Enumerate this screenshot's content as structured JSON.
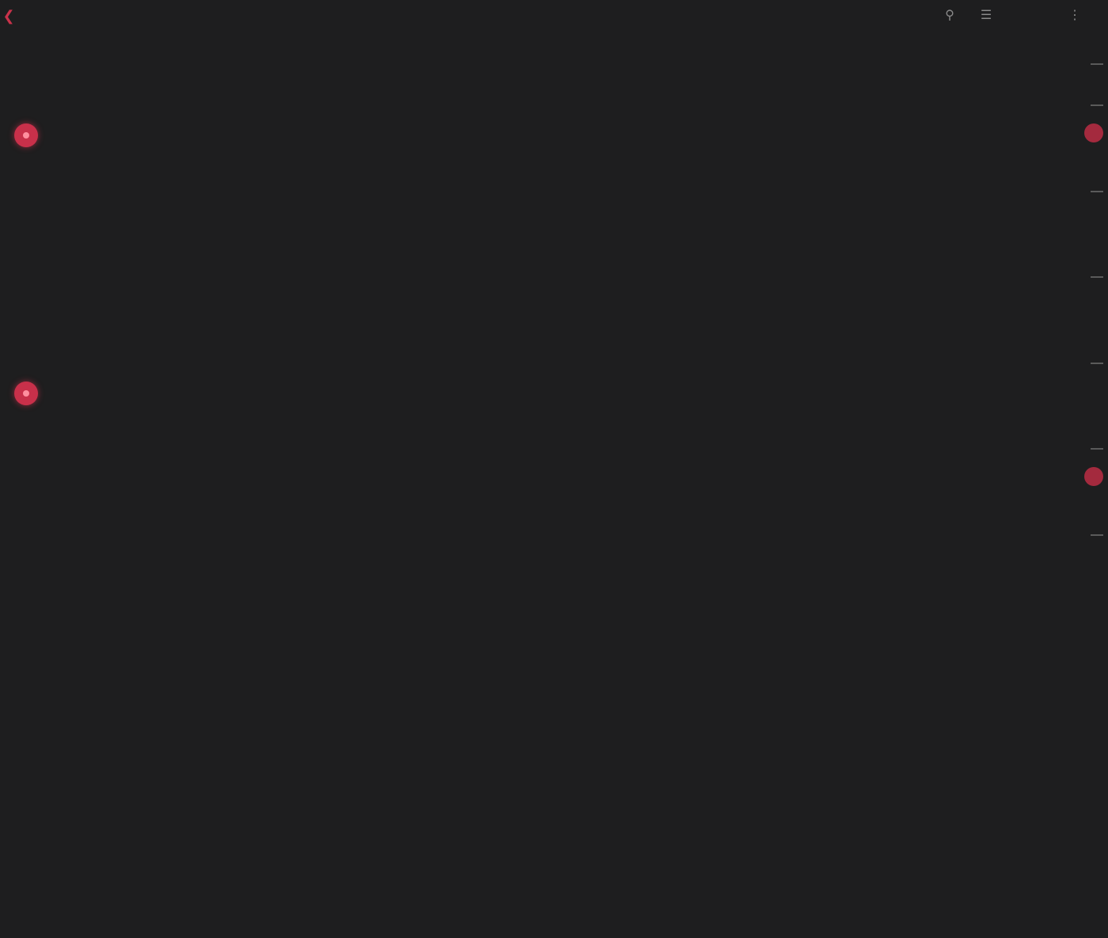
{
  "app": {
    "title": "",
    "back_icon": "chevron-left-icon",
    "toolbar_icons": [
      "search-icon",
      "filter-icon",
      "more-icon"
    ]
  },
  "colors": {
    "background": "#1e1e1f",
    "alert": "#c8304a",
    "text": "#c8c8c8",
    "muted": "#7a7a7a"
  },
  "columns": [
    {
      "title": "",
      "count": "",
      "cards": [
        {
          "meta": "",
          "name": "",
          "sub": "",
          "alert": true
        },
        {
          "meta": "",
          "name": "",
          "sub": "",
          "alert": false
        },
        {
          "meta": "",
          "name": "",
          "sub": "",
          "alert": false
        },
        {
          "meta": "",
          "name": "",
          "sub": "",
          "alert": true
        },
        {
          "meta": "",
          "name": "",
          "sub": "",
          "alert": false
        },
        {
          "meta": "",
          "name": "",
          "sub": "",
          "alert": false
        },
        {
          "meta": "",
          "name": "",
          "sub": "",
          "alert": false
        },
        {
          "meta": "",
          "name": "",
          "sub": "",
          "alert": false
        }
      ]
    },
    {
      "title": "",
      "count": "",
      "cards": [
        {
          "meta": "",
          "name": "",
          "sub": "",
          "alert": false
        },
        {
          "meta": "",
          "name": "",
          "sub": "",
          "alert": false
        },
        {
          "meta": "",
          "name": "",
          "sub": "",
          "alert": false
        },
        {
          "meta": "",
          "name": "",
          "sub": "",
          "alert": false
        },
        {
          "meta": "",
          "name": "",
          "sub": "",
          "alert": false
        },
        {
          "meta": "",
          "name": "",
          "sub": "",
          "alert": false
        },
        {
          "meta": "",
          "name": "",
          "sub": "",
          "alert": false
        },
        {
          "meta": "",
          "name": "",
          "sub": "",
          "alert": false
        },
        {
          "meta": "",
          "name": "",
          "sub": "",
          "alert": false
        },
        {
          "meta": "",
          "name": "",
          "sub": "",
          "alert": false
        }
      ]
    },
    {
      "title": "",
      "count": "",
      "cards": [
        {
          "meta": "",
          "name": "",
          "sub": "",
          "alert": false
        },
        {
          "meta": "",
          "name": "",
          "sub": "",
          "alert": false
        },
        {
          "meta": "",
          "name": "",
          "sub": "",
          "alert": false
        },
        {
          "meta": "",
          "name": "",
          "sub": "",
          "alert": false
        },
        {
          "meta": "",
          "name": "",
          "sub": "",
          "alert": false
        },
        {
          "meta": "",
          "name": "",
          "sub": "",
          "alert": false
        },
        {
          "meta": "",
          "name": "",
          "sub": "",
          "alert": false
        },
        {
          "meta": "",
          "name": "",
          "sub": "",
          "alert": false
        },
        {
          "meta": "",
          "name": "",
          "sub": "",
          "alert": false
        }
      ]
    },
    {
      "title": "",
      "count": "",
      "cards": [
        {
          "meta": "",
          "name": "",
          "sub": "",
          "alert": false
        },
        {
          "meta": "",
          "name": "",
          "sub": "",
          "alert": false
        },
        {
          "meta": "",
          "name": "",
          "sub": "",
          "alert": false
        },
        {
          "meta": "",
          "name": "",
          "sub": "",
          "alert": false
        },
        {
          "meta": "",
          "name": "",
          "sub": "",
          "alert": false
        },
        {
          "meta": "",
          "name": "",
          "sub": "",
          "alert": false
        }
      ]
    }
  ],
  "edge_column": {
    "cells": [
      {
        "alert": true
      },
      {
        "alert": false
      },
      {
        "alert": false
      },
      {
        "alert": false
      },
      {
        "alert": true
      },
      {
        "alert": false
      }
    ]
  }
}
